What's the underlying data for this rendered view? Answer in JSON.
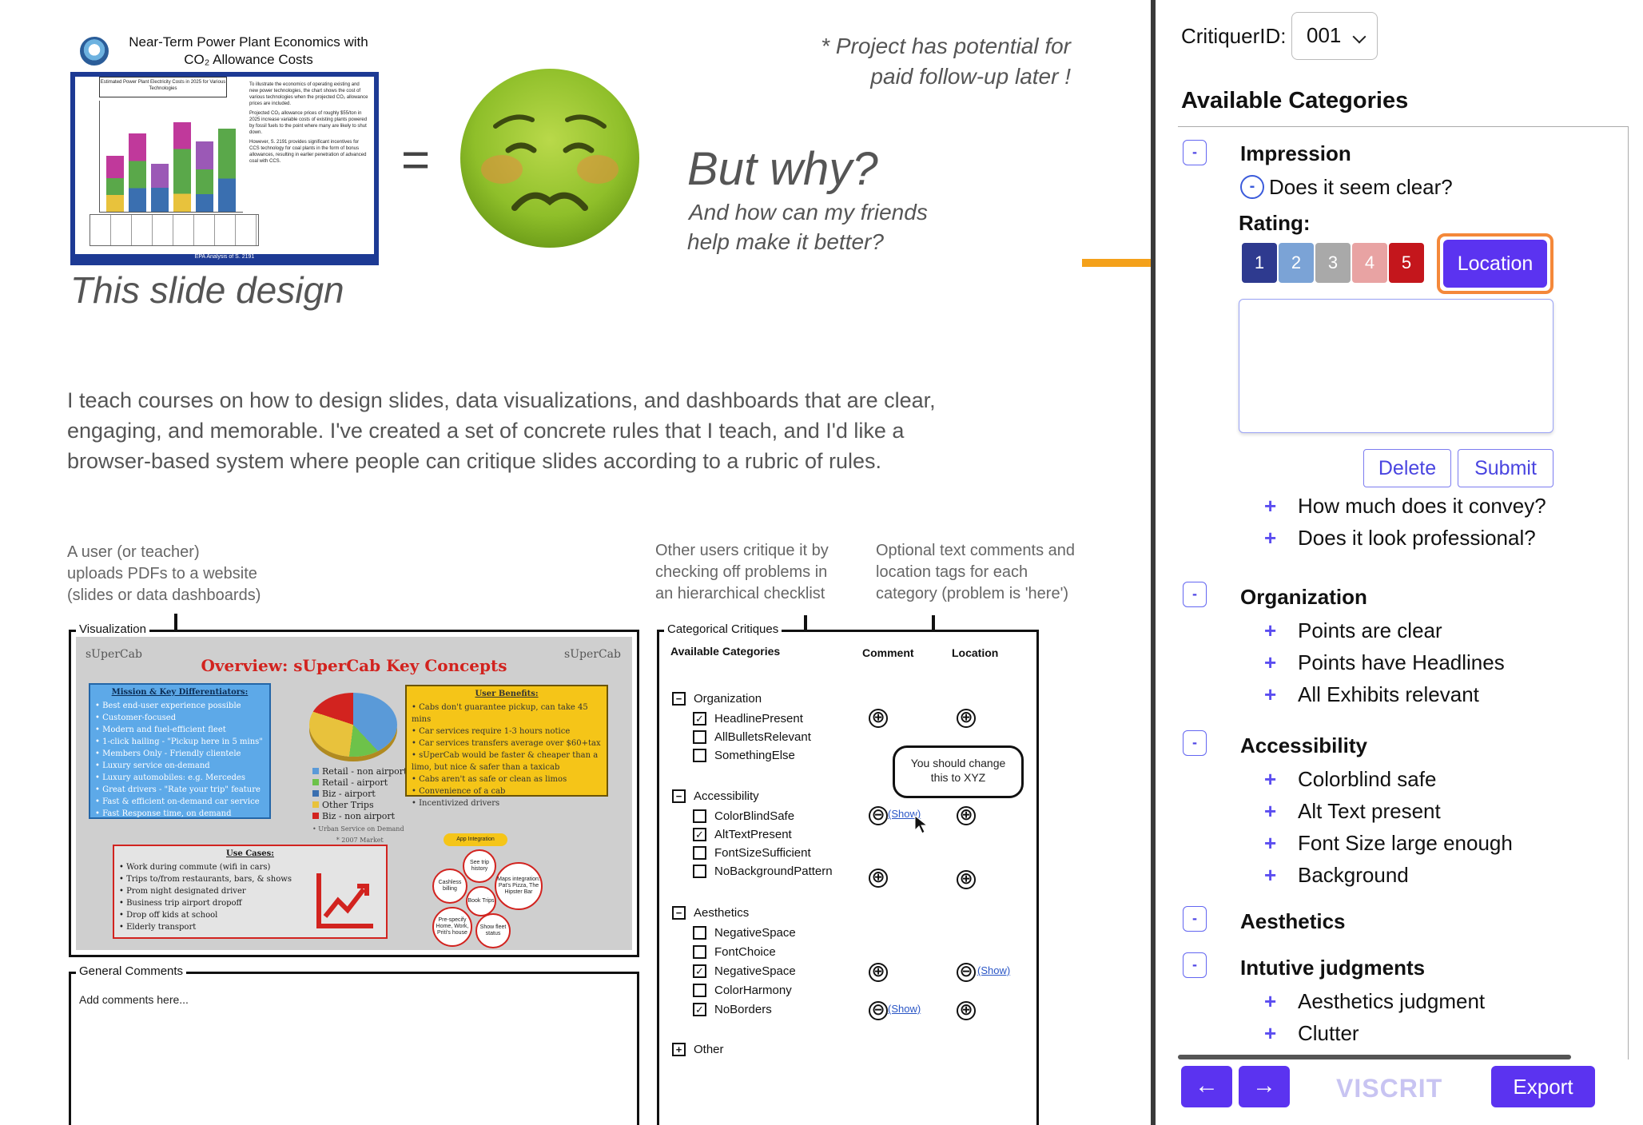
{
  "explainer": {
    "mini_slide": {
      "title_line1": "Near-Term Power Plant Economics with",
      "title_line2": "CO₂ Allowance Costs",
      "chart_heading": "Estimated Power Plant Electricity Costs in 2025 for Various Technologies",
      "notes": [
        "To illustrate the economics of operating existing and new power technologies, the chart shows the cost of various technologies when the projected CO₂ allowance prices are included.",
        "Projected CO₂ allowance prices of roughly $55/ton in 2025 increase variable costs of existing plants powered by fossil fuels to the point where many are likely to shut down.",
        "However, S. 2191 provides significant incentives for CCS technology for coal plants in the form of bonus allowances, resulting in earlier penetration of advanced coal with CCS."
      ],
      "footer": "EPA Analysis of S. 2191"
    },
    "slide_caption": "This slide design",
    "equals": "=",
    "emoji_name": "nauseated-face-icon",
    "but_why": "But why?",
    "friends_line1": "And how can my friends",
    "friends_line2": "help make it better?",
    "potential_line1": "* Project has potential for",
    "potential_line2": "paid follow-up later !",
    "intro_lines": [
      "I teach courses on how to design slides, data visualizations, and dashboards that are clear,",
      "engaging, and memorable. I've created a set of concrete rules that I teach, and I'd like a",
      "browser-based system where people can critique slides according to a rubric of rules."
    ],
    "annotations": {
      "upload": [
        "A user (or teacher)",
        "uploads PDFs to a website",
        "(slides or data dashboards)"
      ],
      "critique": [
        "Other users critique it by",
        "checking off problems in",
        "an hierarchical checklist"
      ],
      "optional": [
        "Optional text comments and",
        "location tags for each",
        "category (problem is 'here')"
      ]
    }
  },
  "sketch": {
    "visualization_label": "Visualization",
    "slide": {
      "logo": "sUperCab",
      "title": "Overview: sUperCab Key Concepts",
      "mission": {
        "header": "Mission & Key Differentiators:",
        "items": [
          "• Best end-user experience possible",
          "  • Customer-focused",
          "  • Modern and fuel-efficient fleet",
          "  • 1-click hailing - \"Pickup here in 5 mins\"",
          "• Members Only - Friendly clientele",
          "  • Luxury service on-demand",
          "     • Luxury automobiles: e.g. Mercedes",
          "• Great drivers - \"Rate your trip\" feature",
          "• Fast & efficient on-demand car service",
          "• Fast Response time, on demand"
        ]
      },
      "benefits": {
        "header": "User Benefits:",
        "items": [
          "• Cabs don't guarantee pickup, can take 45 mins",
          "• Car services require 1-3 hours notice",
          "• Car services transfers average over $60+tax",
          "• sUperCab would be faster & cheaper than a limo, but nice & safer than a taxicab",
          "  • Cabs aren't as safe or clean as limos",
          "  • Convenience of a cab",
          "• Incentivized drivers"
        ]
      },
      "uses": {
        "header": "Use Cases:",
        "items": [
          "• Work during commute (wifi in cars)",
          "• Trips to/from restaurants, bars, & shows",
          "• Prom night designated driver",
          "• Business trip airport dropoff",
          "• Drop off kids at school",
          "• Elderly transport"
        ]
      },
      "pie_legend": [
        {
          "label": "Retail - non airport",
          "color": "#5a9ad8"
        },
        {
          "label": "Retail - airport",
          "color": "#6dc24a"
        },
        {
          "label": "Biz - airport",
          "color": "#3a6fb0"
        },
        {
          "label": "Other Trips",
          "color": "#e8c23c"
        },
        {
          "label": "Biz - non airport",
          "color": "#d2231f"
        }
      ],
      "pie_note": "• Urban Service on Demand",
      "pie_note2": "* 2007 Market",
      "app_tag": "App Integration",
      "bubbles": [
        "See trip history",
        "Cashless billing",
        "Book Trips",
        "Maps integration: Pat's Pizza, The Hipster Bar",
        "Pre-specify Home, Work, Priti's house",
        "Show fleet status"
      ]
    },
    "general_comments_label": "General Comments",
    "general_comments_placeholder": "Add comments here...",
    "crit_label": "Categorical Critiques",
    "crit_col_categories": "Available Categories",
    "crit_col_comment": "Comment",
    "crit_col_location": "Location",
    "groups": [
      {
        "name": "Organization",
        "sign": "−"
      },
      {
        "name": "Accessibility",
        "sign": "−"
      },
      {
        "name": "Aesthetics",
        "sign": "−"
      },
      {
        "name": "Other",
        "sign": "+"
      }
    ],
    "checks": [
      {
        "label": "HeadlinePresent",
        "checked": "✓"
      },
      {
        "label": "AllBulletsRelevant",
        "checked": ""
      },
      {
        "label": "SomethingElse",
        "checked": ""
      },
      {
        "label": "ColorBlindSafe",
        "checked": ""
      },
      {
        "label": "AltTextPresent",
        "checked": "✓"
      },
      {
        "label": "FontSizeSufficient",
        "checked": ""
      },
      {
        "label": "NoBackgroundPattern",
        "checked": ""
      },
      {
        "label": "NegativeSpace",
        "checked": ""
      },
      {
        "label": "FontChoice",
        "checked": ""
      },
      {
        "label": "NegativeSpace",
        "checked": "✓"
      },
      {
        "label": "ColorHarmony",
        "checked": ""
      },
      {
        "label": "NoBorders",
        "checked": "✓"
      }
    ],
    "show_link": "(Show)",
    "speech_line1": "You should change",
    "speech_line2": "this to XYZ",
    "plus_symbol": "⊕",
    "minus_symbol": "⊖"
  },
  "panel": {
    "critiquer_label": "CritiquerID:",
    "critiquer_value": "001",
    "available_heading": "Available Categories",
    "collapse_symbol": "-",
    "plus_symbol": "+",
    "categories": [
      {
        "title": "Impression",
        "items": [
          "How much does it convey?",
          "Does it look professional?"
        ]
      },
      {
        "title": "Organization",
        "items": [
          "Points are clear",
          "Points have Headlines",
          "All Exhibits relevant"
        ]
      },
      {
        "title": "Accessibility",
        "items": [
          "Colorblind safe",
          "Alt Text present",
          "Font Size large enough",
          "Background"
        ]
      },
      {
        "title": "Aesthetics",
        "items": []
      },
      {
        "title": "Intutive judgments",
        "items": [
          "Aesthetics judgment",
          "Clutter"
        ]
      }
    ],
    "open_question": "Does it seem clear?",
    "rating_label": "Rating:",
    "ratings": [
      {
        "label": "1",
        "color": "#2e3a8f"
      },
      {
        "label": "2",
        "color": "#7ba3d6"
      },
      {
        "label": "3",
        "color": "#a9a9a9"
      },
      {
        "label": "4",
        "color": "#e8a3a3"
      },
      {
        "label": "5",
        "color": "#c4161c"
      }
    ],
    "location_label": "Location",
    "comment_value": "",
    "delete_label": "Delete",
    "submit_label": "Submit",
    "prev_label": "←",
    "next_label": "→",
    "brand": "VISCRIT",
    "export_label": "Export",
    "highlight_arrow_color": "#f4a11a",
    "accent_color": "#5b33f0"
  }
}
